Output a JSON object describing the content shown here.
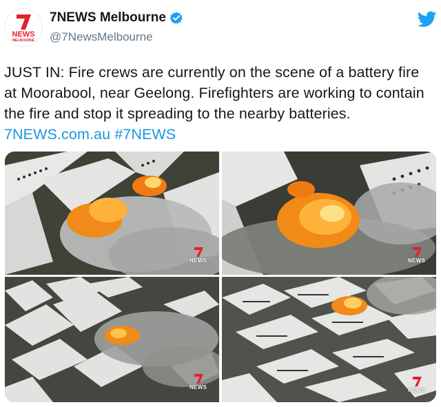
{
  "account": {
    "display_name": "7NEWS Melbourne",
    "handle": "@7NewsMelbourne",
    "avatar_logo": {
      "top": "NEWS",
      "bottom": "MELBOURNE"
    },
    "verified": true
  },
  "tweet": {
    "text": "JUST IN: Fire crews are currently on the scene of a battery fire at Moorabool, near Geelong. Firefighters are working to contain the fire and stop it spreading to the nearby batteries.",
    "link": "7NEWS.com.au",
    "hashtag": "#7NEWS"
  },
  "media": {
    "watermark": "NEWS"
  },
  "colors": {
    "brand_red": "#e4202b",
    "link_blue": "#1b95e0",
    "twitter_blue": "#1da1f2"
  },
  "icons": [
    "verified-badge-icon",
    "twitter-bird-icon",
    "seven-logo-icon"
  ]
}
